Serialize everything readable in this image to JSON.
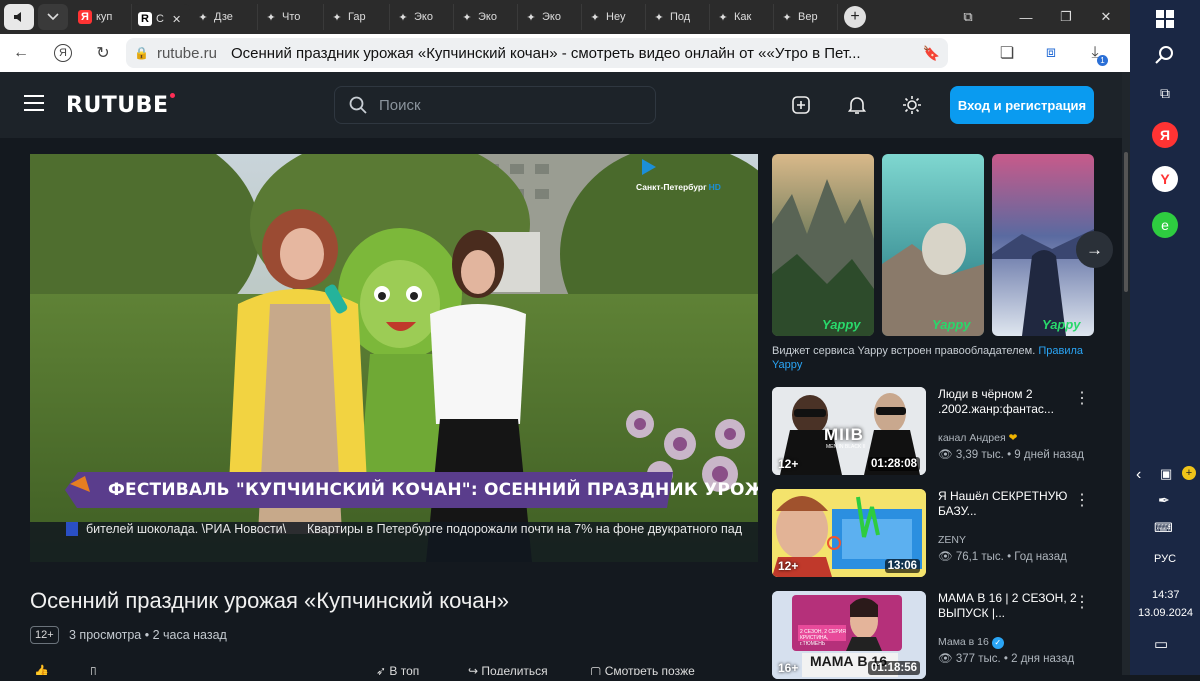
{
  "browser": {
    "tabs": [
      {
        "label": "куп",
        "icon": "yandex-icon"
      },
      {
        "label": "С",
        "icon": "rutube-icon",
        "active": true
      },
      {
        "label": "Дзе",
        "icon": "sparkle-icon"
      },
      {
        "label": "Что",
        "icon": "sparkle-icon"
      },
      {
        "label": "Гар",
        "icon": "sparkle-icon"
      },
      {
        "label": "Эко",
        "icon": "sparkle-icon"
      },
      {
        "label": "Эко",
        "icon": "sparkle-icon"
      },
      {
        "label": "Эко",
        "icon": "sparkle-icon"
      },
      {
        "label": "Неу",
        "icon": "sparkle-icon"
      },
      {
        "label": "Под",
        "icon": "sparkle-icon"
      },
      {
        "label": "Как",
        "icon": "sparkle-icon"
      },
      {
        "label": "Вер",
        "icon": "sparkle-icon"
      }
    ],
    "domain": "rutube.ru",
    "page_title": "Осенний праздник урожая «Купчинский кочан» - смотреть видео онлайн от ««Утро в Пет...",
    "download_count": "1"
  },
  "header": {
    "logo": "RUTUBE",
    "search_placeholder": "Поиск",
    "login_label": "Вход и регистрация"
  },
  "video": {
    "title": "Осенний праздник урожая «Купчинский кочан»",
    "age": "12+",
    "views": "3 просмотра",
    "time_ago": "2 часа назад",
    "banner": "ФЕСТИВАЛЬ \"КУПЧИНСКИЙ КОЧАН\": ОСЕННИЙ ПРАЗДНИК УРОЖАЯ",
    "ticker": "бителей шоколада. \\РИА Новости\\      Квартиры в Петербурге подорожали почти на 7% на фоне двукратного пад",
    "channel_logo": "Санкт-Петербург",
    "channel_logo_hd": "HD",
    "actions": [
      "",
      "",
      "В топ",
      "Поделиться",
      "Смотреть позже"
    ]
  },
  "yappy": {
    "watermark": "Yappy",
    "note": "Виджет сервиса Yappy встроен правообладателем.",
    "note_link": "Правила Yappy"
  },
  "recommendations": [
    {
      "title": "Люди в чёрном 2 .2002.жанр:фантас...",
      "channel": "канал Андрея",
      "views": "3,39 тыс.",
      "ago": "9 дней назад",
      "age": "12+",
      "duration": "01:28:08",
      "thumb_text": "MIIB",
      "thumb_sub": "MEN IN BLACK II"
    },
    {
      "title": "Я Нашёл СЕКРЕТНУЮ БАЗУ...",
      "channel": "ZENY",
      "views": "76,1 тыс.",
      "ago": "Год назад",
      "age": "12+",
      "duration": "13:06"
    },
    {
      "title": "МАМА В 16 | 2 СЕЗОН, 2 ВЫПУСК |...",
      "channel": "Мама в 16",
      "views": "377 тыс.",
      "ago": "2 дня назад",
      "age": "16+",
      "duration": "01:18:56",
      "thumb_text": "МАМА В 16",
      "thumb_sub": "2 СЕЗОН, 2 СЕРИЯ КРИСТИНА, г.ТЮМЕНЬ"
    }
  ],
  "system": {
    "lang": "РУС",
    "time": "14:37",
    "date": "13.09.2024"
  },
  "colors": {
    "accent": "#0a9bf0",
    "bg": "#14191f",
    "header": "#1d2329",
    "yappy": "#29d86b",
    "banner": "#5a3d8c"
  }
}
